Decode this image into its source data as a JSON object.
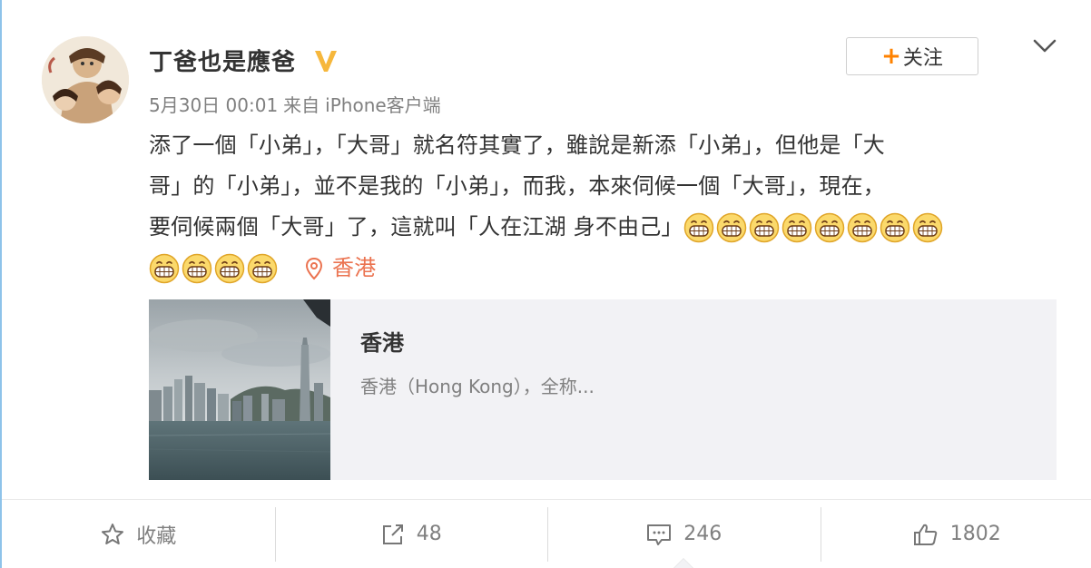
{
  "post": {
    "username": "丁爸也是應爸",
    "verified_badge": "V",
    "date": "5月30日 00:01",
    "source_prefix": "来自",
    "source": "iPhone客户端",
    "follow_plus": "+",
    "follow_label": "关注",
    "menu_icon": "chevron-down-icon",
    "content_lines": [
      "添了一個「小弟」，「大哥」就名符其實了，雖說是新添「小弟」，但他是「大",
      "哥」的「小弟」，並不是我的「小弟」，而我，本來伺候一個「大哥」，現在，",
      "要伺候兩個「大哥」了，這就叫「人在江湖 身不由己」"
    ],
    "emoji_name": "grin-emoji",
    "emoji_count_line3": 8,
    "emoji_count_line4": 4,
    "location_label": "香港"
  },
  "location_card": {
    "title": "香港",
    "description": "香港（Hong Kong），全称..."
  },
  "actions": {
    "favorite_label": "收藏",
    "repost_count": "48",
    "comment_count": "246",
    "like_count": "1802"
  },
  "colors": {
    "accent_orange": "#ff8200",
    "location_red": "#eb7350",
    "verified_gold": "#f6b73c",
    "muted_text": "#808080"
  }
}
